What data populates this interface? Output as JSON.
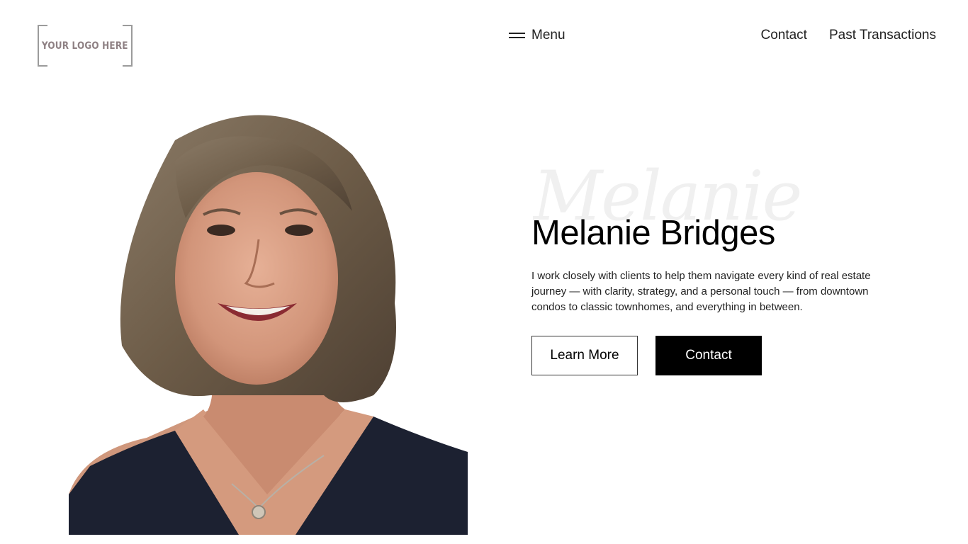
{
  "header": {
    "logo_text": "YOUR LOGO HERE",
    "menu_label": "Menu",
    "nav_links": [
      "Contact",
      "Past Transactions"
    ]
  },
  "hero": {
    "script_name": "Melanie",
    "name": "Melanie Bridges",
    "description": "I work closely with clients to help them navigate every kind of real estate journey — with clarity, strategy, and a personal touch — from downtown condos to classic townhomes, and everything in between.",
    "buttons": {
      "learn_more": "Learn More",
      "contact": "Contact"
    }
  },
  "colors": {
    "background": "#ffffff",
    "text": "#000000",
    "button_solid_bg": "#000000",
    "button_solid_text": "#ffffff",
    "script_watermark": "#f0f0f0",
    "logo_text": "#8e8083"
  },
  "icons": {
    "menu": "hamburger-icon"
  }
}
